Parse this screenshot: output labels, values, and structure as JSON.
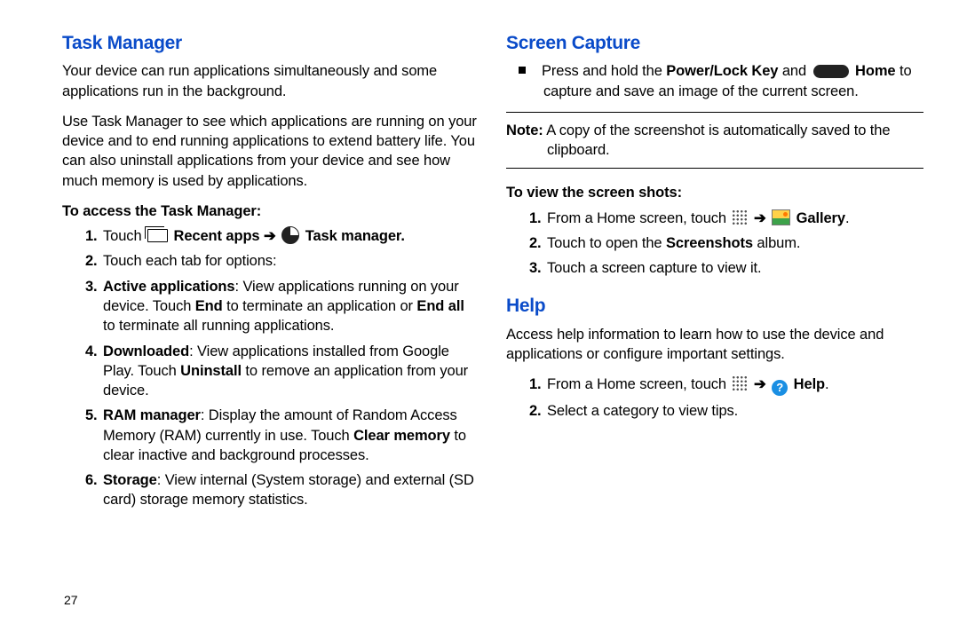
{
  "page_number": "27",
  "left": {
    "heading": "Task Manager",
    "p1": "Your device can run applications simultaneously and some applications run in the background.",
    "p2": "Use Task Manager to see which applications are running on your device and to end running applications to extend battery life. You can also uninstall applications from your device and see how much memory is used by applications.",
    "sub": "To access the Task Manager:",
    "li1a": "Touch ",
    "li1b": " Recent apps ",
    "li1c": " Task manager.",
    "li2": "Touch each tab for options:",
    "li3a": "Active applications",
    "li3b": ": View applications running on your device. Touch ",
    "li3c": "End",
    "li3d": " to terminate an application or ",
    "li3e": "End all",
    "li3f": " to terminate all running applications.",
    "li4a": "Downloaded",
    "li4b": ": View applications installed from Google Play. Touch ",
    "li4c": "Uninstall",
    "li4d": " to remove an application from your device.",
    "li5a": "RAM manager",
    "li5b": ": Display the amount of Random Access Memory (RAM) currently in use. Touch ",
    "li5c": "Clear memory",
    "li5d": " to clear inactive and background processes.",
    "li6a": "Storage",
    "li6b": ": View internal (System storage) and external (SD card) storage memory statistics."
  },
  "right": {
    "heading1": "Screen Capture",
    "cap1a": "Press and hold the ",
    "cap1b": "Power/Lock Key",
    "cap1c": " and ",
    "cap1d": " Home",
    "cap1e": " to capture and save an image of the current screen.",
    "noteLabel": "Note:",
    "noteTextA": " A copy of the screenshot is automatically saved to the",
    "noteTextB": "clipboard.",
    "sub": "To view the screen shots:",
    "v1a": "From a Home screen, touch ",
    "v1b": " Gallery",
    "v2a": "Touch to open the ",
    "v2b": "Screenshots",
    "v2c": " album.",
    "v3": "Touch a screen capture to view it.",
    "heading2": "Help",
    "helpPara": "Access help information to learn how to use the device and applications or configure important settings.",
    "h1a": "From a Home screen, touch ",
    "h1b": " Help",
    "h2": "Select a category to view tips."
  },
  "arrow": "➔"
}
